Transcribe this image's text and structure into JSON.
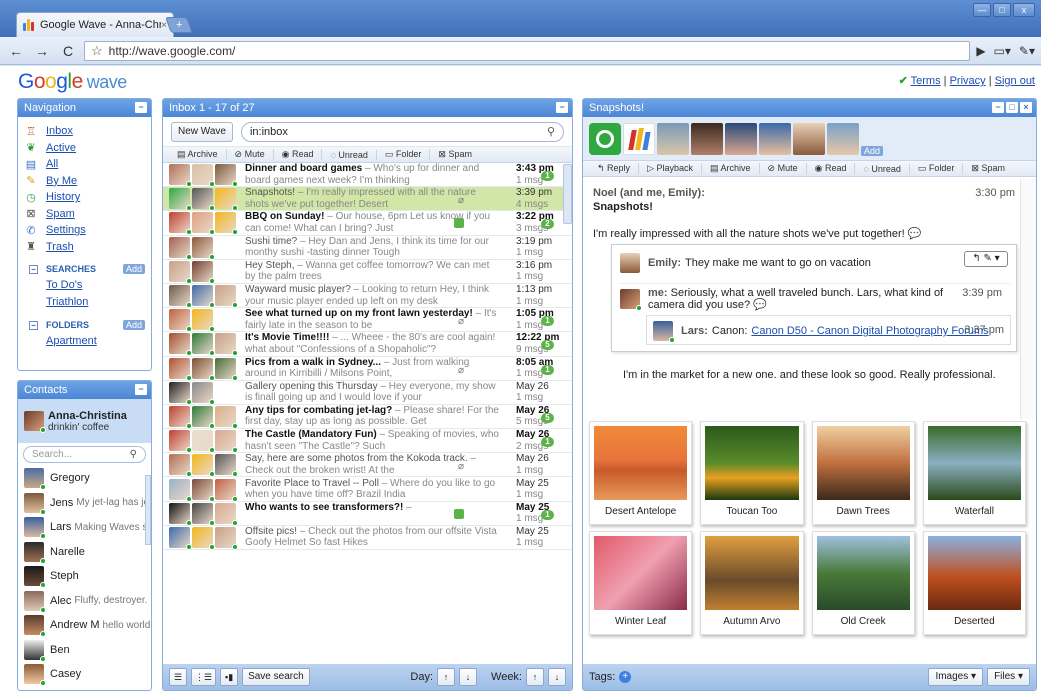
{
  "browser": {
    "tab_title": "Google Wave - Anna-Christ...",
    "tab_close": "×",
    "new_tab": "+",
    "url": "http://wave.google.com/",
    "win_min": "—",
    "win_max": "□",
    "win_close": "x"
  },
  "header": {
    "logo_g": "G",
    "logo_o1": "o",
    "logo_o2": "o",
    "logo_g2": "g",
    "logo_l": "l",
    "logo_e": "e",
    "logo_wave": "wave",
    "terms": "Terms",
    "privacy": "Privacy",
    "signout": "Sign out",
    "sep": "|"
  },
  "navigation": {
    "title": "Navigation",
    "items": [
      "Inbox",
      "Active",
      "All",
      "By Me",
      "History",
      "Spam",
      "Settings",
      "Trash"
    ],
    "searches_label": "SEARCHES",
    "add_label": "Add",
    "searches": [
      "To Do's",
      "Triathlon"
    ],
    "folders_label": "FOLDERS",
    "folders": [
      "Apartment"
    ]
  },
  "contacts": {
    "title": "Contacts",
    "me_name": "Anna-Christina",
    "me_status": "drinkin' coffee",
    "search_placeholder": "Search...",
    "list": [
      {
        "name": "Gregory",
        "status": ""
      },
      {
        "name": "Jens",
        "status": "My jet-lag has jet-lag..."
      },
      {
        "name": "Lars",
        "status": "Making Waves since 2007"
      },
      {
        "name": "Narelle",
        "status": ""
      },
      {
        "name": "Steph",
        "status": ""
      },
      {
        "name": "Alec",
        "status": "Fluffy, destroyer."
      },
      {
        "name": "Andrew M",
        "status": "hello world"
      },
      {
        "name": "Ben",
        "status": ""
      },
      {
        "name": "Casey",
        "status": ""
      }
    ]
  },
  "inbox": {
    "title": "Inbox 1 - 17 of 27",
    "new_wave": "New Wave",
    "query": "in:inbox",
    "actions": [
      "Archive",
      "Mute",
      "Read",
      "Unread",
      "Folder",
      "Spam"
    ],
    "waves": [
      {
        "title": "Dinner and board games",
        "snippet": " – Who's up for dinner and board games next week? I'm thinking",
        "time": "3:43 pm",
        "count": "1 msg",
        "badge": "1",
        "unread": true
      },
      {
        "title": "Snapshots!",
        "snippet": " – I'm really impressed with all the nature shots we've put together! Desert",
        "time": "3:39 pm",
        "count": "4 msgs",
        "badge": "",
        "unread": false
      },
      {
        "title": "BBQ on Sunday!",
        "snippet": " – Our house, 6pm Let us know if you can come! What can I bring? Just",
        "time": "3:22 pm",
        "count": "3 msgs",
        "badge": "2",
        "unread": true
      },
      {
        "title": "Sushi time?",
        "snippet": " – Hey Dan and Jens, I think its time for our monthy sushi -tasting dinner Tough",
        "time": "3:19 pm",
        "count": "1 msg",
        "badge": "",
        "unread": false
      },
      {
        "title": "Hey Steph,",
        "snippet": " – Wanna get coffee tomorrow? We can met by the palm trees",
        "time": "3:16 pm",
        "count": "1 msg",
        "badge": "",
        "unread": false
      },
      {
        "title": "Wayward music player?",
        "snippet": " – Looking to return Hey, I think your music player ended up left on my desk",
        "time": "1:13 pm",
        "count": "1 msg",
        "badge": "",
        "unread": false
      },
      {
        "title": "See what turned up on my front lawn yesterday!",
        "snippet": " – It's fairly late in the season to be",
        "time": "1:05 pm",
        "count": "1 msg",
        "badge": "1",
        "unread": true
      },
      {
        "title": "It's Movie Time!!!!",
        "snippet": " – ... Wheee - the 80's are cool again! what about \"Confessions of a Shopaholic\"?",
        "time": "12:22 pm",
        "count": "9 msgs",
        "badge": "5",
        "unread": true
      },
      {
        "title": "Pics from a walk in Sydney...",
        "snippet": " – Just from walking around in Kirribilli / Milsons Point,",
        "time": "8:05 am",
        "count": "1 msg",
        "badge": "1",
        "unread": true
      },
      {
        "title": "Gallery opening this Thursday",
        "snippet": " – Hey everyone, my show is finall going up and I would love if your",
        "time": "May 26",
        "count": "1 msg",
        "badge": "",
        "unread": false
      },
      {
        "title": "Any tips for combating jet-lag?",
        "snippet": " – Please share! For the first day, stay up as long as possible. Get",
        "time": "May 26",
        "count": "5 msgs",
        "badge": "5",
        "unread": true
      },
      {
        "title": "The Castle (Mandatory Fun)",
        "snippet": " – Speaking of movies, who hasn't seen \"The Castle\"? Such",
        "time": "May 26",
        "count": "2 msgs",
        "badge": "1",
        "unread": true
      },
      {
        "title": "Say, here are some photos from the Kokoda track.",
        "snippet": " – Check out the broken wrist! At the",
        "time": "May 26",
        "count": "1 msg",
        "badge": "",
        "unread": false
      },
      {
        "title": "Favorite Place to Travel -- Poll",
        "snippet": " – Where do you like to go when you have time off? Brazil India",
        "time": "May 25",
        "count": "1 msg",
        "badge": "",
        "unread": false
      },
      {
        "title": "Who wants to see transformers?!",
        "snippet": " –",
        "time": "May 25",
        "count": "1 msg",
        "badge": "1",
        "unread": true
      },
      {
        "title": "Offsite pics!",
        "snippet": " – Check out the photos from our offsite Vista Goofy Helmet So fast Hikes",
        "time": "May 25",
        "count": "1 msg",
        "badge": "",
        "unread": false
      }
    ],
    "save_search": "Save search",
    "day_label": "Day:",
    "week_label": "Week:"
  },
  "snapshots": {
    "title": "Snapshots!",
    "add_label": "Add",
    "actions": [
      "Reply",
      "Playback",
      "Archive",
      "Mute",
      "Read",
      "Unread",
      "Folder",
      "Spam"
    ],
    "root_author": "Noel (and me, Emily):",
    "root_title": "Snapshots!",
    "root_time": "3:30 pm",
    "root_body": "I'm really impressed with all the nature shots we've put together!",
    "emily_author": "Emily:",
    "emily_text": "They make me want to go on vacation",
    "me_author": "me:",
    "me_text": "Seriously, what a well traveled bunch. Lars, what kind of camera did you use?",
    "me_time": "3:39 pm",
    "lars_author": "Lars:",
    "lars_prefix": "Canon:",
    "lars_link": "Canon D50 - Canon Digital Photography Forums",
    "lars_time": "3:37 pm",
    "market_text": "I'm in the market for a new one. and these look so good. Really professional.",
    "photos": [
      "Desert Antelope",
      "Toucan Too",
      "Dawn Trees",
      "Waterfall",
      "Winter Leaf",
      "Autumn Arvo",
      "Old Creek",
      "Deserted"
    ],
    "tags_label": "Tags:",
    "images_btn": "Images",
    "files_btn": "Files"
  }
}
